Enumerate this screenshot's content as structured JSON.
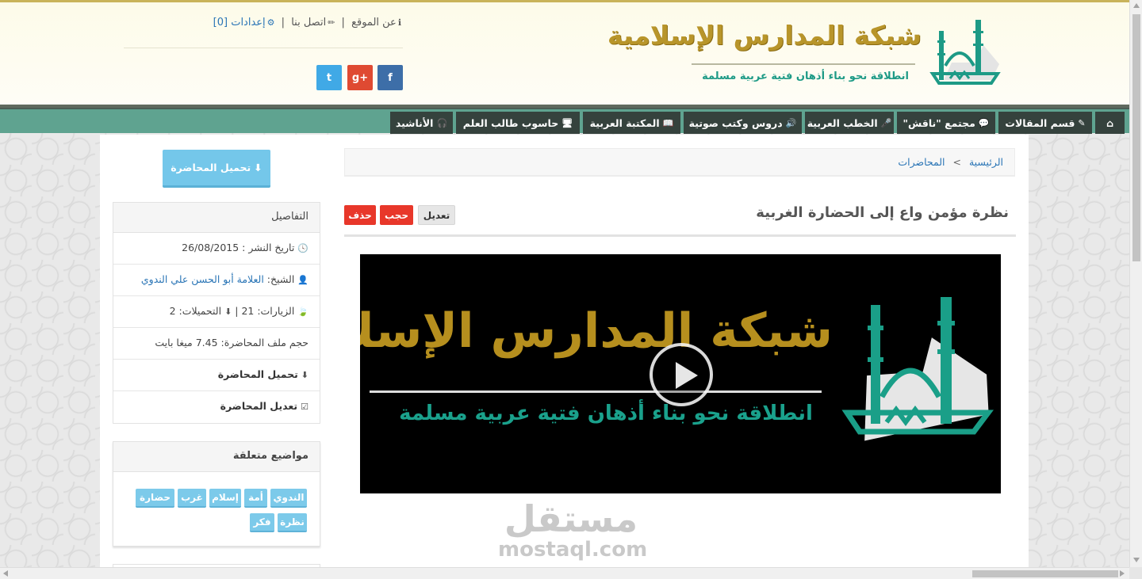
{
  "site": {
    "title": "شبكة المدارس الإسلامية",
    "slogan": "انطلاقة نحو بناء أذهان فتية عربية مسلمة",
    "brand_gold": "#b8952a",
    "brand_teal": "#1d9a86"
  },
  "toplinks": {
    "about": "عن الموقع",
    "contact": "اتصل بنا",
    "settings": "إعدادات [0]",
    "separator": "|"
  },
  "social": {
    "facebook": "f",
    "googleplus": "g+",
    "twitter": "t"
  },
  "nav": {
    "home_icon": "⌂",
    "items": [
      {
        "label": "قسم المقالات",
        "icon": "✎"
      },
      {
        "label": "مجتمع \"ناقش\"",
        "icon": "💬"
      },
      {
        "label": "الخطب العربية",
        "icon": "🎤"
      },
      {
        "label": "دروس وكتب صوتية",
        "icon": "🔊"
      },
      {
        "label": "المكتبة العربية",
        "icon": "📖"
      },
      {
        "label": "حاسوب طالب العلم",
        "icon": "🖥"
      },
      {
        "label": "الأناشيد",
        "icon": "🎧"
      }
    ]
  },
  "breadcrumb": {
    "home": "الرئيسية",
    "separator": ">",
    "current": "المحاضرات"
  },
  "lecture": {
    "title": "نظرة مؤمن واع إلى الحضارة الغربية",
    "edit_label": "تعديل",
    "hide_label": "حجب",
    "delete_label": "حذف"
  },
  "video": {
    "title": "شبكة المدارس الإسلامية",
    "slogan": "انطلاقة نحو بناء أذهان فتية عربية مسلمة"
  },
  "watermark": {
    "arabic": "مستقل",
    "latin": "mostaql.com"
  },
  "sidebar": {
    "download_button": "تحميل المحاضرة",
    "details": {
      "heading": "التفاصيل",
      "publish_label": "تاريخ النشر : 26/08/2015",
      "sheikh_label": "الشيخ: ",
      "sheikh_name": "العلامة أبو الحسن علي الندوي",
      "stats": "الزيارات: 21 | ",
      "downloads": "التحميلات: 2",
      "filesize": "حجم ملف المحاضرة: 7.45 ميغا بايت",
      "download_link": "تحميل المحاضرة",
      "edit_link": "تعديل المحاضرة"
    },
    "topics": {
      "heading": "مواضيع متعلقة",
      "tags": [
        "الندوي",
        "أمة",
        "إسلام",
        "غرب",
        "حضارة",
        "نظرة",
        "فكر"
      ]
    }
  }
}
